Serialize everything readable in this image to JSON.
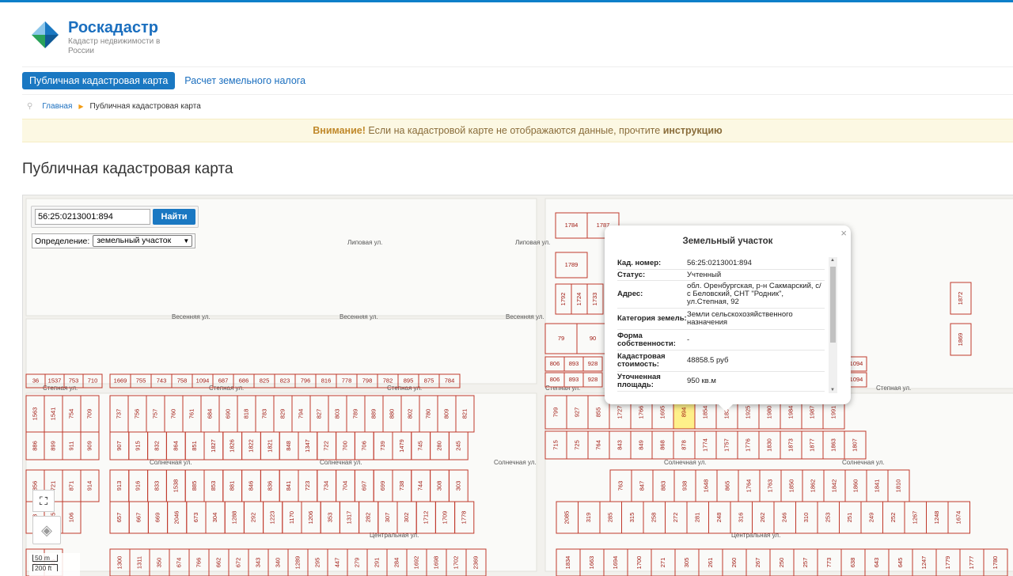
{
  "brand": {
    "title": "Роскадастр",
    "subtitle": "Кадастр недвижимости в России"
  },
  "nav": {
    "active": "Публичная кадастровая карта",
    "link": "Расчет земельного налога"
  },
  "breadcrumb": {
    "home": "Главная",
    "current": "Публичная кадастровая карта"
  },
  "notice": {
    "warning": "Внимание!",
    "text": " Если на кадастровой карте не отображаются данные, прочтите ",
    "link": "инструкцию"
  },
  "page_title": "Публичная кадастровая карта",
  "search": {
    "value": "56:25:0213001:894",
    "button": "Найти",
    "def_label": "Определение:",
    "def_value": "земельный участок"
  },
  "streets": [
    "Липовая ул.",
    "Липовая ул.",
    "Весенняя ул.",
    "Весенняя ул.",
    "Весенняя ул.",
    "Степная ул.",
    "Степная ул.",
    "Степная ул.",
    "Солнечная ул.",
    "Солнечная ул.",
    "Солнечная ул.",
    "Солнечная ул.",
    "Солнечная ул.",
    "Центральная ул.",
    "Центральная ул."
  ],
  "popup": {
    "title": "Земельный участок",
    "rows": [
      {
        "k": "Кад. номер:",
        "v": "56:25:0213001:894"
      },
      {
        "k": "Статус:",
        "v": "Учтенный"
      },
      {
        "k": "Адрес:",
        "v": "обл. Оренбургская, р-н Сакмарский, с/с Беловский, СНТ \"Родник\", ул.Степная, 92"
      },
      {
        "k": "Категория земель:",
        "v": "Земли сельскохозяйственного назначения"
      },
      {
        "k": "Форма собственности:",
        "v": "-"
      },
      {
        "k": "Кадастровая стоимость:",
        "v": "48858.5 руб"
      },
      {
        "k": "Уточненная площадь:",
        "v": "950 кв.м"
      }
    ]
  },
  "scale": {
    "a": "50 m",
    "b": "200 ft"
  },
  "parcels": {
    "r1": [
      "36",
      "1537",
      "753",
      "710",
      "1669",
      "755",
      "743",
      "758",
      "1094",
      "687",
      "686",
      "825",
      "823",
      "796",
      "816",
      "778",
      "798",
      "782",
      "895",
      "875",
      "784"
    ],
    "r2": [
      "1563",
      "1541",
      "754",
      "709",
      "737",
      "756",
      "757",
      "760",
      "761",
      "684",
      "690",
      "818",
      "783",
      "829",
      "794",
      "827",
      "803",
      "789",
      "889",
      "880",
      "802",
      "780",
      "809",
      "821"
    ],
    "r3": [
      "886",
      "899",
      "911",
      "909",
      "907",
      "915",
      "832",
      "864",
      "851",
      "1827",
      "1826",
      "1822",
      "1821",
      "848",
      "1347",
      "722",
      "700",
      "706",
      "739",
      "1479",
      "745",
      "280",
      "245"
    ],
    "r4": [
      "856",
      "721",
      "871",
      "914",
      "913",
      "916",
      "833",
      "1538",
      "885",
      "853",
      "881",
      "846",
      "836",
      "841",
      "723",
      "734",
      "704",
      "697",
      "699",
      "738",
      "744",
      "308",
      "303"
    ],
    "r5": [
      "88",
      "105",
      "106",
      "657",
      "667",
      "669",
      "2046",
      "673",
      "304",
      "1288",
      "292",
      "1223",
      "1170",
      "1206",
      "353",
      "1317",
      "282",
      "307",
      "302",
      "1712",
      "1709",
      "1778"
    ],
    "r6": [
      "6",
      "45",
      "1300",
      "1311",
      "350",
      "674",
      "766",
      "662",
      "672",
      "343",
      "340",
      "1289",
      "295",
      "447",
      "279",
      "291",
      "284",
      "1692",
      "1698",
      "1702",
      "2369"
    ],
    "rr1": [
      "799",
      "927",
      "855",
      "1727",
      "1766",
      "1695",
      "894",
      "1854",
      "1839",
      "1925",
      "1980",
      "1984",
      "1987",
      "1991"
    ],
    "rr2": [
      "715",
      "725",
      "764",
      "843",
      "849",
      "868",
      "878",
      "1774",
      "1757",
      "1776",
      "1830",
      "1873",
      "1877",
      "1863",
      "1807"
    ],
    "rr3": [
      "763",
      "847",
      "883",
      "938",
      "1648",
      "865",
      "1764",
      "1763",
      "1850",
      "1862",
      "1842",
      "1860",
      "1841",
      "1810"
    ],
    "rr4": [
      "2085",
      "319",
      "285",
      "315",
      "258",
      "272",
      "281",
      "248",
      "316",
      "262",
      "246",
      "310",
      "253",
      "251",
      "249",
      "252",
      "1267",
      "1248",
      "1674"
    ],
    "rr5": [
      "1834",
      "1663",
      "1694",
      "1700",
      "271",
      "305",
      "261",
      "260",
      "267",
      "250",
      "257",
      "773",
      "638",
      "643",
      "645",
      "1247",
      "1779",
      "1777",
      "1780"
    ],
    "top": [
      "1784",
      "1787",
      "1789",
      "1792",
      "1724",
      "1733",
      "79",
      "90",
      "806",
      "893",
      "928",
      "806",
      "893",
      "928",
      "1872",
      "1869",
      "1094",
      "1094"
    ]
  }
}
